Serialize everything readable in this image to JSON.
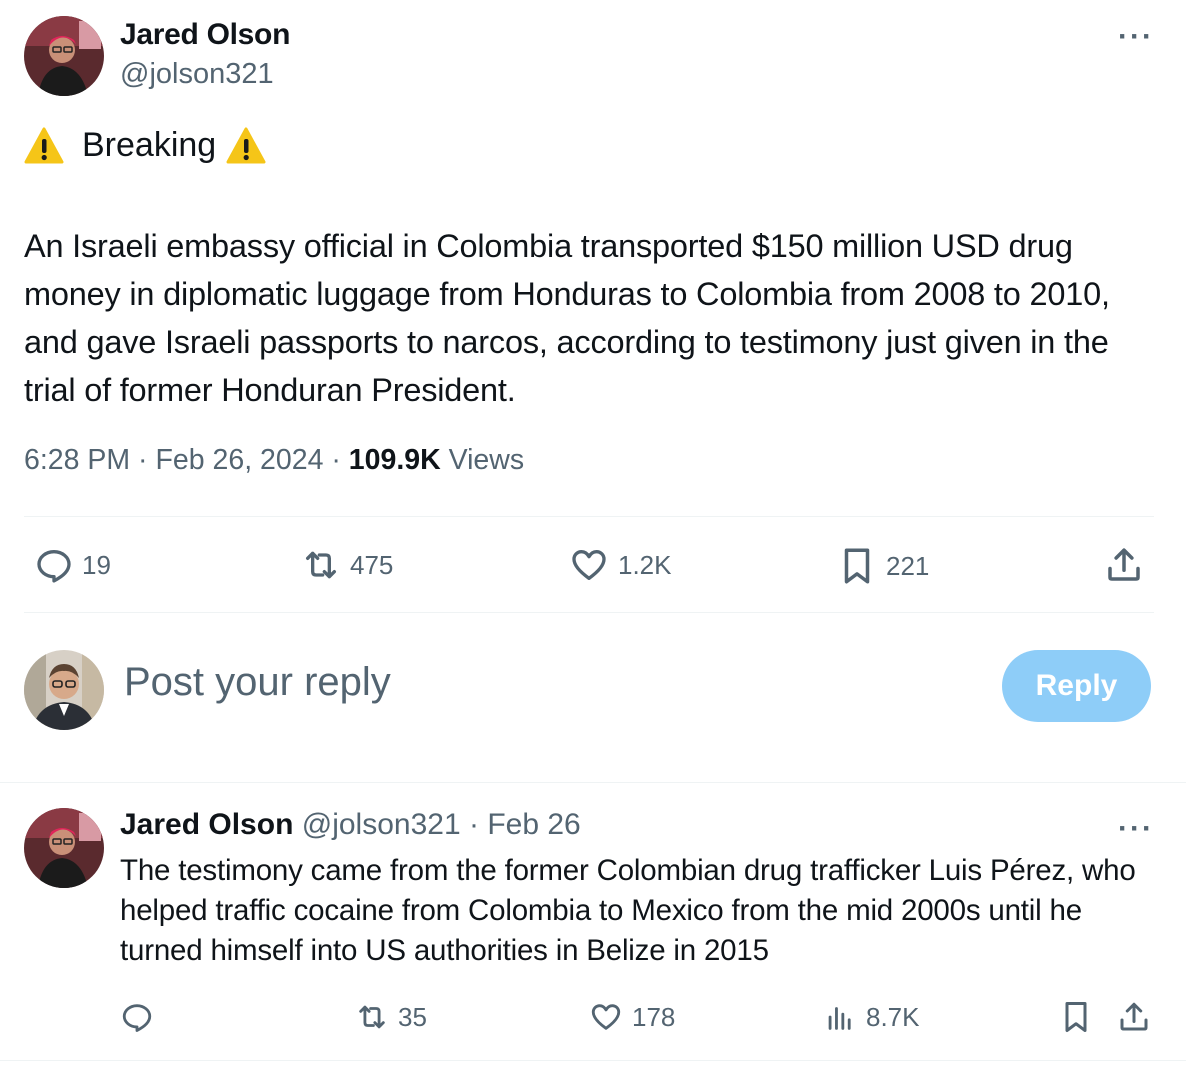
{
  "tweet": {
    "author_name": "Jared Olson",
    "author_handle": "@jolson321",
    "more_label": "···",
    "breaking_label": "Breaking",
    "text": "An Israeli embassy official in Colombia transported $150 million USD drug money in diplomatic luggage from Honduras to Colombia from 2008 to 2010, and gave Israeli passports to narcos, according to testimony just given in the trial of former Honduran President.",
    "time": "6:28 PM",
    "date": "Feb 26, 2024",
    "separator": " · ",
    "views_count": "109.9K",
    "views_label": "Views",
    "stats": {
      "replies": "19",
      "reposts": "475",
      "likes": "1.2K",
      "bookmarks": "221"
    }
  },
  "composer": {
    "placeholder": "Post your reply",
    "reply_button": "Reply"
  },
  "reply_tweet": {
    "author_name": "Jared Olson",
    "author_handle": "@jolson321",
    "date_sep": " · ",
    "date": "Feb 26",
    "more_label": "···",
    "text": "The testimony came from the former Colombian drug trafficker Luis Pérez, who helped traffic cocaine from Colombia to Mexico from the mid 2000s until he turned himself into US authorities in Belize in 2015",
    "stats": {
      "reposts": "35",
      "likes": "178",
      "views": "8.7K"
    }
  },
  "colors": {
    "secondary_text": "#536471",
    "divider": "#eff3f4",
    "reply_button_bg": "#8ecdf8",
    "warning": "#f5c518"
  }
}
